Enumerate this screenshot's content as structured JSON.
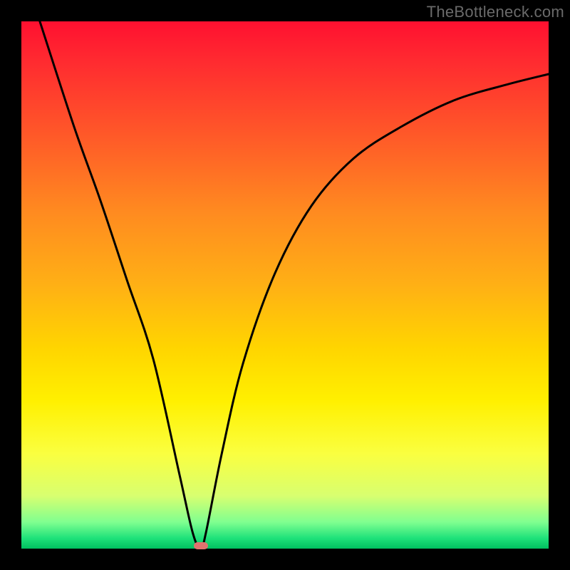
{
  "watermark": "TheBottleneck.com",
  "chart_data": {
    "type": "line",
    "title": "",
    "xlabel": "",
    "ylabel": "",
    "xlim": [
      0,
      1
    ],
    "ylim": [
      0,
      1
    ],
    "series": [
      {
        "name": "curve",
        "x": [
          0.035,
          0.1,
          0.15,
          0.2,
          0.25,
          0.3,
          0.325,
          0.34,
          0.35,
          0.38,
          0.42,
          0.48,
          0.55,
          0.63,
          0.72,
          0.82,
          0.92,
          1.0
        ],
        "y": [
          1.0,
          0.8,
          0.66,
          0.51,
          0.36,
          0.14,
          0.03,
          0.0,
          0.03,
          0.18,
          0.35,
          0.52,
          0.65,
          0.74,
          0.8,
          0.85,
          0.88,
          0.9
        ]
      }
    ],
    "marker": {
      "x": 0.34,
      "y": 0.0
    },
    "gradient_stops": [
      {
        "pos": 0.0,
        "color": "#ff1030"
      },
      {
        "pos": 0.5,
        "color": "#ffd500"
      },
      {
        "pos": 0.82,
        "color": "#faff40"
      },
      {
        "pos": 1.0,
        "color": "#00c060"
      }
    ]
  }
}
